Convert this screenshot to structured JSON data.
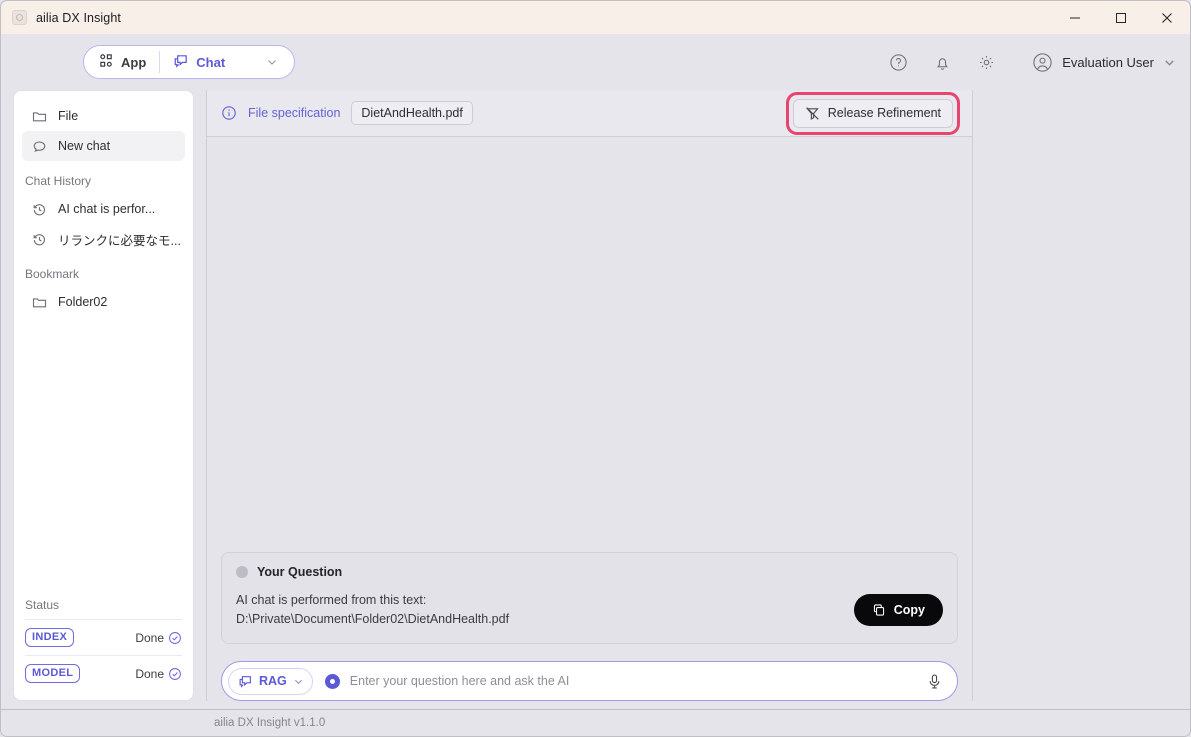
{
  "window": {
    "title": "ailia DX Insight",
    "app_icon": "app-logo-icon",
    "minimize_label": "Minimize",
    "maximize_label": "Maximize",
    "close_label": "Close"
  },
  "header": {
    "mode_switch": {
      "app_label": "App",
      "app_icon": "grid-apps-icon",
      "chat_label": "Chat",
      "chat_icon": "chat-bubble-icon",
      "caret_icon": "chevron-down-icon"
    },
    "help_icon": "help-circle-icon",
    "notification_icon": "bell-icon",
    "settings_icon": "gear-icon",
    "avatar_icon": "user-avatar-icon",
    "user_name": "Evaluation User",
    "user_caret_icon": "chevron-down-icon"
  },
  "sidebar": {
    "items": [
      {
        "label": "File",
        "icon": "folder-icon",
        "selected": false
      },
      {
        "label": "New chat",
        "icon": "chat-bubble-icon",
        "selected": true
      }
    ],
    "chat_history_group": "Chat History",
    "history": [
      {
        "label": "AI chat is perfor...",
        "icon": "history-clock-icon"
      },
      {
        "label": "リランクに必要なモ...",
        "icon": "history-clock-icon"
      }
    ],
    "bookmark_group": "Bookmark",
    "bookmarks": [
      {
        "label": "Folder02",
        "icon": "folder-icon"
      }
    ],
    "status_title": "Status",
    "status_rows": [
      {
        "badge": "INDEX",
        "value": "Done",
        "icon": "check-circle-icon"
      },
      {
        "badge": "MODEL",
        "value": "Done",
        "icon": "check-circle-icon"
      }
    ]
  },
  "main": {
    "file_bar": {
      "info_icon": "info-circle-icon",
      "label": "File specification",
      "file_name": "DietAndHealth.pdf",
      "refine_button_label": "Release Refinement",
      "refine_button_icon": "filter-off-icon"
    },
    "question_card": {
      "title": "Your Question",
      "line1": "AI chat is performed from this text:",
      "line2": "D:\\Private\\Document\\Folder02\\DietAndHealth.pdf",
      "copy_label": "Copy",
      "copy_icon": "copy-icon"
    },
    "input_bar": {
      "rag_label": "RAG",
      "rag_icon": "chat-bubble-icon",
      "rag_caret_icon": "chevron-down-icon",
      "mode_dot_icon": "record-dot-icon",
      "placeholder": "Enter your question here and ask the AI",
      "value": "",
      "mic_icon": "microphone-icon"
    }
  },
  "status_bar": {
    "version_text": "ailia DX Insight v1.1.0"
  },
  "colors": {
    "accent": "#5b59d6",
    "highlight_ring": "#e8456e",
    "titlebar": "#f8efe9",
    "app_bg": "#e5e4ea"
  }
}
